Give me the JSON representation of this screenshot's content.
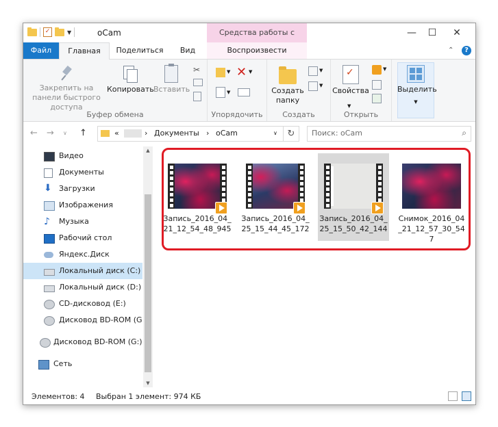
{
  "window": {
    "title": "oCam",
    "context_group": "Средства работы с видео",
    "controls": {
      "minimize": "—",
      "maximize": "☐",
      "close": "✕"
    }
  },
  "tabs": [
    {
      "label": "Файл"
    },
    {
      "label": "Главная"
    },
    {
      "label": "Поделиться"
    },
    {
      "label": "Вид"
    },
    {
      "label": "Воспроизвести"
    }
  ],
  "ribbon": {
    "clipboard": {
      "pin_label": "Закрепить на панели быстрого доступа",
      "copy_label": "Копировать",
      "paste_label": "Вставить",
      "group_label": "Буфер обмена"
    },
    "organize": {
      "group_label": "Упорядочить"
    },
    "create": {
      "new_folder_label": "Создать папку",
      "group_label": "Создать"
    },
    "open": {
      "properties_label": "Свойства",
      "group_label": "Открыть"
    },
    "select": {
      "select_label": "Выделить"
    }
  },
  "address": {
    "prefix": "«",
    "crumbs": [
      "Документы",
      "oCam"
    ],
    "separator": "›",
    "search_placeholder": "Поиск: oCam"
  },
  "nav": {
    "items": [
      {
        "label": "Видео",
        "icon": "video-icon"
      },
      {
        "label": "Документы",
        "icon": "documents-icon"
      },
      {
        "label": "Загрузки",
        "icon": "downloads-icon"
      },
      {
        "label": "Изображения",
        "icon": "pictures-icon"
      },
      {
        "label": "Музыка",
        "icon": "music-icon"
      },
      {
        "label": "Рабочий стол",
        "icon": "desktop-icon"
      },
      {
        "label": "Яндекс.Диск",
        "icon": "yandex-disk-icon"
      },
      {
        "label": "Локальный диск (C:)",
        "icon": "drive-icon",
        "selected": true
      },
      {
        "label": "Локальный диск (D:)",
        "icon": "drive-icon"
      },
      {
        "label": "CD-дисковод (E:)",
        "icon": "cd-drive-icon"
      },
      {
        "label": "Дисковод BD-ROM (G:)",
        "icon": "bd-drive-icon"
      },
      {
        "label": "Дисковод BD-ROM (G:) F",
        "icon": "bd-drive-icon"
      },
      {
        "label": "Сеть",
        "icon": "network-icon"
      }
    ]
  },
  "files": [
    {
      "name": "Запись_2016_04_21_12_54_48_945",
      "type": "video",
      "thumb": "pink"
    },
    {
      "name": "Запись_2016_04_25_15_44_45_172",
      "type": "video",
      "thumb": "blue"
    },
    {
      "name": "Запись_2016_04_25_15_50_42_144",
      "type": "video",
      "thumb": "grey",
      "selected": true
    },
    {
      "name": "Снимок_2016_04_21_12_57_30_547",
      "type": "image",
      "thumb": "pink"
    }
  ],
  "status": {
    "count": "Элементов: 4",
    "selection": "Выбран 1 элемент: 974 КБ"
  },
  "colors": {
    "accent": "#1979ca",
    "context_tab": "#f7d3e8",
    "highlight": "#e01b24",
    "selection": "#cce4f7"
  }
}
